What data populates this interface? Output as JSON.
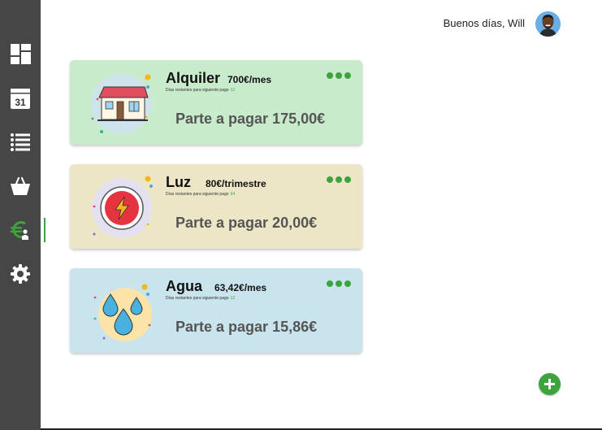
{
  "header": {
    "greeting": "Buenos días, Will"
  },
  "sidebar": {
    "items": [
      {
        "name": "dashboard-icon"
      },
      {
        "name": "calendar-icon",
        "label": "31"
      },
      {
        "name": "list-icon"
      },
      {
        "name": "shopping-bag-icon"
      },
      {
        "name": "euro-payment-icon",
        "active": true
      },
      {
        "name": "settings-gear-icon"
      }
    ]
  },
  "colors": {
    "sidebar_bg": "#464646",
    "accent_green": "#3da33d",
    "card_rent_bg": "#c8ebcc",
    "card_electric_bg": "#ede6c6",
    "card_water_bg": "#c9e4ec"
  },
  "cards": [
    {
      "name": "Alquiler",
      "price": "700€/mes",
      "days_label": "Días restantes para siguiente pago",
      "days_value": "12",
      "pay_text": "Parte a pagar 175,00€",
      "icon": "house-icon"
    },
    {
      "name": "Luz",
      "price": "80€/trimestre",
      "days_label": "Días restantes para siguiente pago",
      "days_value": "64",
      "pay_text": "Parte a pagar 20,00€",
      "icon": "lightning-icon"
    },
    {
      "name": "Agua",
      "price": "63,42€/mes",
      "days_label": "Días restantes para siguiente pago",
      "days_value": "12",
      "pay_text": "Parte a pagar 15,86€",
      "icon": "water-drops-icon"
    }
  ],
  "fab": {
    "icon": "plus-icon"
  }
}
